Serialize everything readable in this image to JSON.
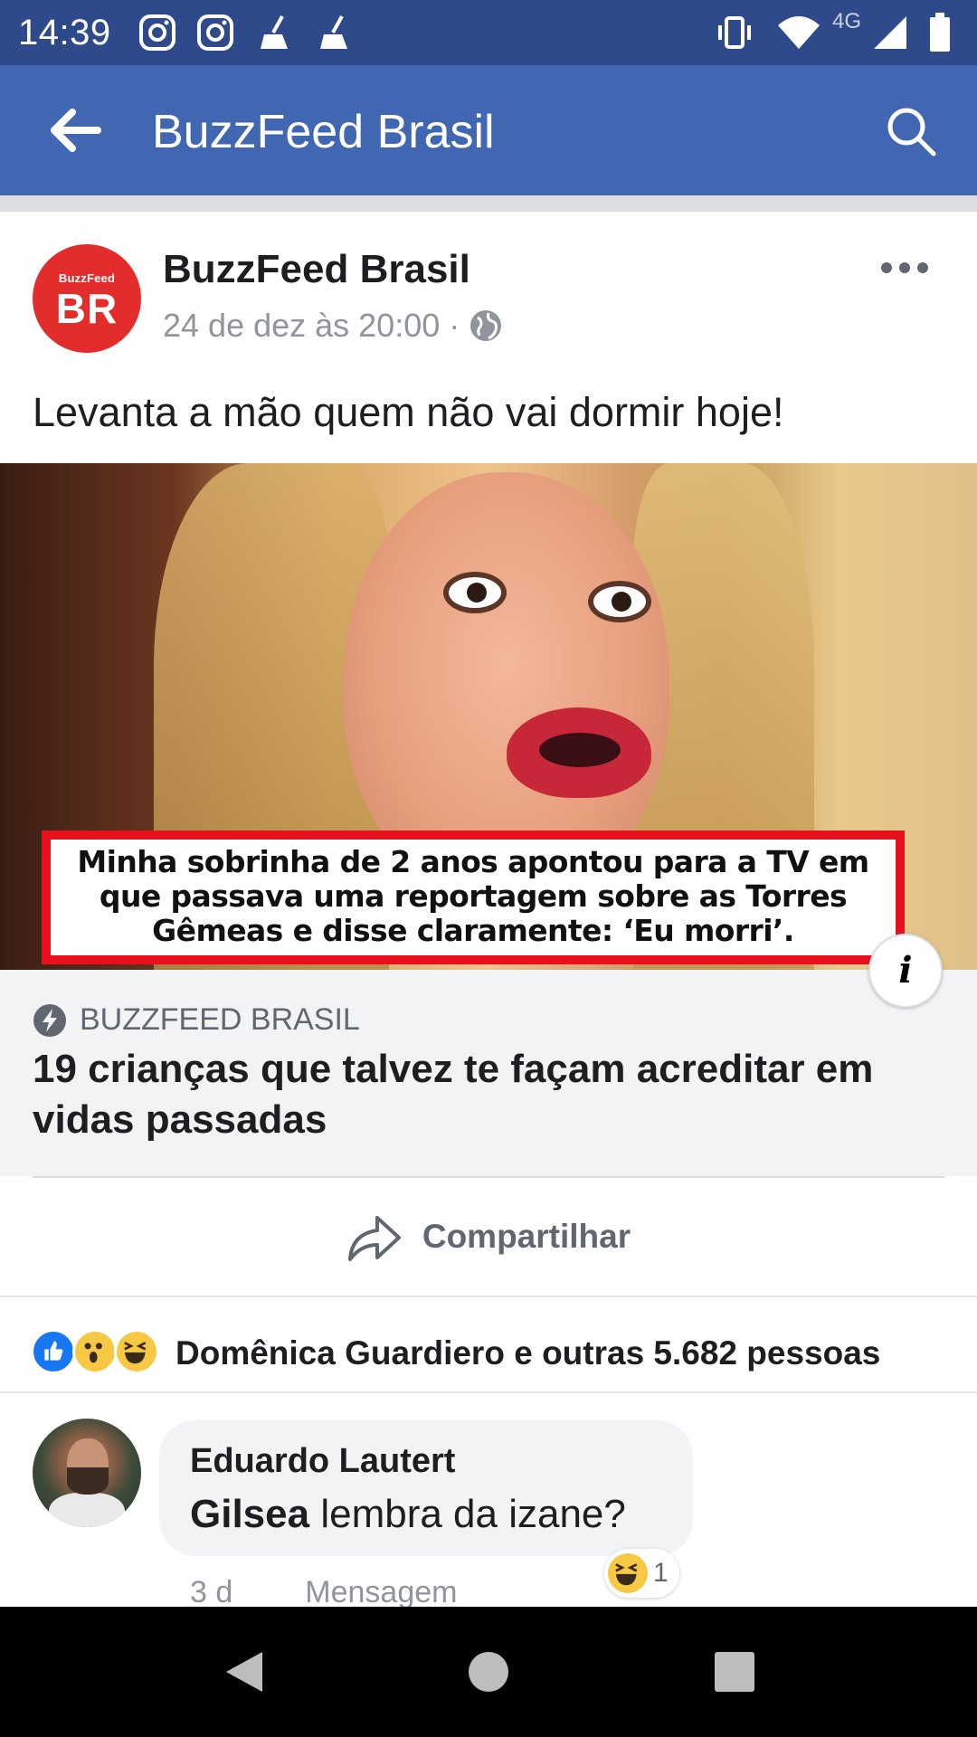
{
  "status_bar": {
    "time": "14:39",
    "network": "4G",
    "icons": [
      "instagram-icon",
      "instagram-icon",
      "cleaner-icon",
      "cleaner-icon",
      "vibrate-icon",
      "wifi-icon",
      "signal-icon",
      "battery-icon"
    ]
  },
  "app_bar": {
    "title": "BuzzFeed Brasil",
    "color": "#4267b2"
  },
  "post": {
    "avatar_small": "BuzzFeed",
    "avatar_big": "BR",
    "author": "BuzzFeed Brasil",
    "timestamp": "24 de dez às 20:00 ·",
    "text": "Levanta a mão quem não vai dormir hoje!",
    "image_caption": "Minha sobrinha de 2 anos apontou para a TV em que passava uma reportagem sobre as Torres Gêmeas e disse claramente: ‘Eu morri’.",
    "info_label": "i"
  },
  "link_preview": {
    "source": "BUZZFEED BRASIL",
    "title": "19 crianças que talvez te façam acreditar em vidas passadas"
  },
  "share": {
    "label": "Compartilhar"
  },
  "reactions": {
    "types": [
      "like",
      "wow",
      "haha"
    ],
    "summary": "Domênica Guardiero e outras 5.682 pessoas"
  },
  "comment": {
    "author": "Eduardo Lautert",
    "mention": "Gilsea",
    "text": " lembra da izane?",
    "reaction_count": "1",
    "time": "3 d",
    "action": "Mensagem"
  }
}
